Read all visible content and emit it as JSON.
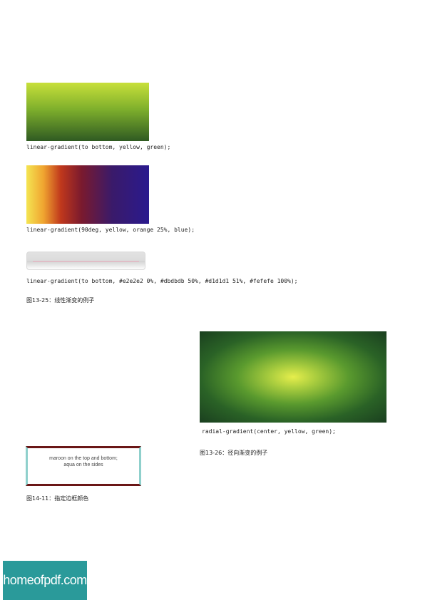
{
  "figure_13_25": {
    "code_1": "linear-gradient(to bottom, yellow, green);",
    "code_2": "linear-gradient(90deg, yellow, orange 25%, blue);",
    "code_3": "linear-gradient(to bottom, #e2e2e2 0%, #dbdbdb 50%, #d1d1d1 51%, #fefefe 100%);",
    "caption": "图13-25：线性渐变的例子"
  },
  "figure_13_26": {
    "code": "radial-gradient(center, yellow, green);",
    "caption": "图13-26：径向渐变的例子"
  },
  "figure_14_11": {
    "box_text_line1": "maroon on the top and bottom;",
    "box_text_line2": "aqua on the sides",
    "caption": "图14-11：指定边框颜色",
    "colors": {
      "top_bottom": "#6a1616",
      "sides": "#8fd0cc"
    }
  },
  "watermark": {
    "text": "homeofpdf.com",
    "background": "#2a9a9a"
  }
}
